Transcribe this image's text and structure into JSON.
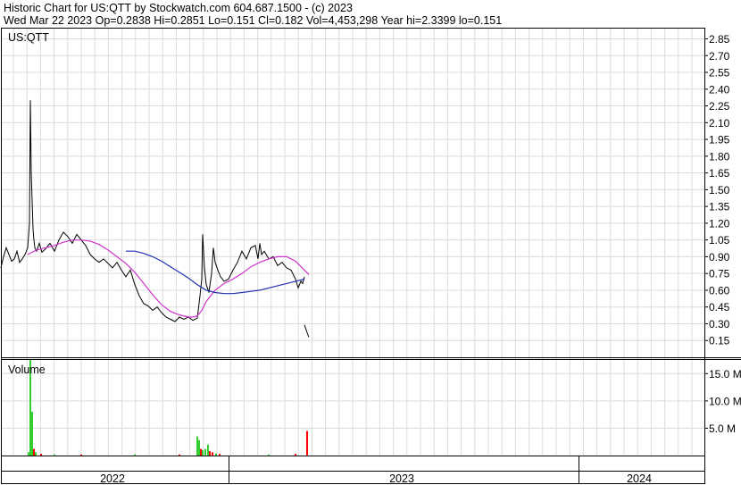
{
  "header": {
    "line1": "Historic Chart for US:QTT by Stockwatch.com 604.687.1500 - (c) 2023",
    "line2": "Wed Mar 22 2023   Op=0.2838   Hi=0.2851   Lo=0.151   Cl=0.182   Vol=4,453,298   Year hi=2.3399   lo=0.151"
  },
  "chart_data": [
    {
      "type": "line",
      "symbol_label": "US:QTT",
      "ylim": [
        0,
        2.95
      ],
      "y_ticks": [
        "2.85",
        "2.70",
        "2.55",
        "2.40",
        "2.25",
        "2.10",
        "1.95",
        "1.80",
        "1.65",
        "1.50",
        "1.35",
        "1.20",
        "1.05",
        "0.90",
        "0.75",
        "0.60",
        "0.45",
        "0.30",
        "0.15"
      ],
      "series": [
        {
          "color": "#000000",
          "x": [
            0,
            3,
            6,
            9,
            12,
            15,
            18,
            21,
            24,
            27,
            30,
            32,
            33,
            34,
            35,
            36,
            37,
            38,
            40,
            43,
            46,
            50,
            55,
            60,
            65,
            70,
            75,
            80,
            85,
            90,
            95,
            100,
            105,
            110,
            115,
            120,
            125,
            130,
            135,
            140,
            145,
            150,
            155,
            160,
            165,
            170,
            175,
            180,
            185,
            190,
            195,
            200,
            205,
            210,
            215,
            220,
            223,
            225,
            226,
            228,
            230,
            233,
            236,
            238,
            240,
            243,
            246,
            250,
            255,
            260,
            265,
            270,
            275,
            280,
            285,
            288,
            290,
            292,
            295,
            300,
            305,
            310,
            315,
            320,
            325,
            330,
            333,
            336,
            338,
            340
          ],
          "y": [
            0.8,
            0.9,
            0.98,
            0.92,
            0.86,
            0.88,
            0.95,
            0.85,
            0.88,
            0.92,
            0.98,
            1.2,
            2.3,
            1.65,
            1.4,
            1.15,
            1.05,
            0.98,
            0.95,
            1.02,
            0.94,
            0.97,
            1.02,
            0.95,
            1.05,
            1.12,
            1.08,
            1.02,
            1.1,
            1.05,
            1.0,
            0.92,
            0.88,
            0.85,
            0.88,
            0.84,
            0.8,
            0.85,
            0.78,
            0.72,
            0.78,
            0.65,
            0.55,
            0.48,
            0.46,
            0.42,
            0.45,
            0.4,
            0.36,
            0.34,
            0.32,
            0.36,
            0.34,
            0.36,
            0.33,
            0.35,
            0.55,
            0.7,
            1.1,
            0.8,
            0.65,
            0.58,
            0.75,
            0.98,
            0.85,
            0.78,
            0.72,
            0.68,
            0.7,
            0.78,
            0.85,
            0.95,
            0.88,
            0.98,
            1.0,
            0.88,
            1.02,
            0.92,
            0.95,
            0.88,
            0.9,
            0.82,
            0.85,
            0.8,
            0.78,
            0.7,
            0.62,
            0.68,
            0.66,
            0.72
          ]
        },
        {
          "color": "#000000",
          "x": [
            340,
            343,
            345
          ],
          "y": [
            0.29,
            0.22,
            0.18
          ]
        },
        {
          "color": "#cc33cc",
          "x": [
            30,
            40,
            50,
            60,
            70,
            80,
            90,
            100,
            110,
            120,
            130,
            140,
            150,
            160,
            170,
            180,
            190,
            200,
            210,
            215,
            220,
            225,
            230,
            240,
            250,
            260,
            270,
            280,
            290,
            300,
            310,
            320,
            330,
            340,
            345
          ],
          "y": [
            0.92,
            0.96,
            0.98,
            1.0,
            1.03,
            1.05,
            1.05,
            1.04,
            1.01,
            0.96,
            0.9,
            0.84,
            0.76,
            0.66,
            0.56,
            0.47,
            0.41,
            0.38,
            0.36,
            0.36,
            0.37,
            0.42,
            0.5,
            0.6,
            0.66,
            0.7,
            0.75,
            0.81,
            0.85,
            0.88,
            0.9,
            0.9,
            0.86,
            0.78,
            0.74
          ]
        },
        {
          "color": "#1f2fb0",
          "x": [
            140,
            150,
            160,
            170,
            180,
            190,
            200,
            210,
            220,
            230,
            240,
            250,
            260,
            270,
            280,
            290,
            300,
            310,
            320,
            330,
            340
          ],
          "y": [
            0.95,
            0.95,
            0.93,
            0.9,
            0.86,
            0.81,
            0.76,
            0.71,
            0.65,
            0.6,
            0.58,
            0.57,
            0.57,
            0.58,
            0.59,
            0.6,
            0.62,
            0.64,
            0.66,
            0.68,
            0.7
          ]
        }
      ]
    },
    {
      "type": "bar",
      "title": "Volume",
      "ylim": [
        0,
        17.5
      ],
      "y_ticks": [
        "15.0 M",
        "10.0 M",
        "5.0 M"
      ],
      "bars": [
        {
          "x": 31,
          "v": 0.6,
          "color": "#33cc33"
        },
        {
          "x": 33,
          "v": 17.5,
          "color": "#33cc33"
        },
        {
          "x": 35,
          "v": 8.0,
          "color": "#33cc33"
        },
        {
          "x": 37,
          "v": 1.2,
          "color": "#ff0000"
        },
        {
          "x": 39,
          "v": 0.6,
          "color": "#33cc33"
        },
        {
          "x": 45,
          "v": 0.3,
          "color": "#ff0000"
        },
        {
          "x": 60,
          "v": 0.2,
          "color": "#33cc33"
        },
        {
          "x": 90,
          "v": 0.2,
          "color": "#ff0000"
        },
        {
          "x": 150,
          "v": 0.2,
          "color": "#33cc33"
        },
        {
          "x": 200,
          "v": 0.2,
          "color": "#ff0000"
        },
        {
          "x": 220,
          "v": 3.5,
          "color": "#33cc33"
        },
        {
          "x": 222,
          "v": 2.8,
          "color": "#33cc33"
        },
        {
          "x": 224,
          "v": 1.2,
          "color": "#ff0000"
        },
        {
          "x": 226,
          "v": 1.0,
          "color": "#33cc33"
        },
        {
          "x": 229,
          "v": 1.2,
          "color": "#33cc33"
        },
        {
          "x": 232,
          "v": 2.0,
          "color": "#33cc33"
        },
        {
          "x": 234,
          "v": 0.8,
          "color": "#ff0000"
        },
        {
          "x": 237,
          "v": 0.6,
          "color": "#ff0000"
        },
        {
          "x": 241,
          "v": 0.4,
          "color": "#33cc33"
        },
        {
          "x": 245,
          "v": 0.3,
          "color": "#ff0000"
        },
        {
          "x": 300,
          "v": 0.2,
          "color": "#33cc33"
        },
        {
          "x": 330,
          "v": 0.3,
          "color": "#ff0000"
        },
        {
          "x": 343,
          "v": 4.5,
          "color": "#ff0000"
        }
      ]
    }
  ],
  "x_axis": {
    "labels": [
      "2022",
      "2023",
      "2024"
    ]
  }
}
